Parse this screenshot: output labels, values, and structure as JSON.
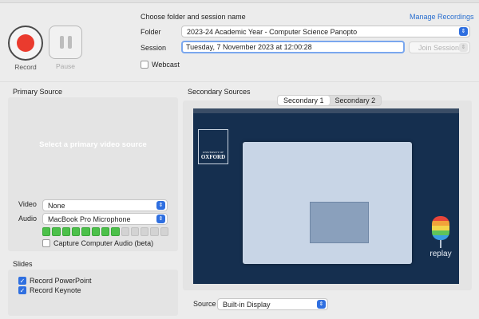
{
  "recording": {
    "record_label": "Record",
    "pause_label": "Pause"
  },
  "session": {
    "choose_label": "Choose folder and session name",
    "manage_link": "Manage Recordings",
    "folder_label": "Folder",
    "folder_value": "2023-24 Academic Year - Computer Science Panopto",
    "session_label": "Session",
    "session_value": "Tuesday, 7 November 2023 at 12:00:28",
    "join_label": "Join Session",
    "webcast_label": "Webcast",
    "webcast_checked": false
  },
  "primary": {
    "title": "Primary Source",
    "message": "Select a primary video source",
    "video_label": "Video",
    "video_value": "None",
    "audio_label": "Audio",
    "audio_value": "MacBook Pro Microphone",
    "audio_level_segments_lit": 8,
    "audio_level_segments_total": 13,
    "capture_label": "Capture Computer Audio (beta)",
    "capture_checked": false
  },
  "slides": {
    "title": "Slides",
    "powerpoint_label": "Record PowerPoint",
    "powerpoint_checked": true,
    "keynote_label": "Record Keynote",
    "keynote_checked": true
  },
  "secondary": {
    "title": "Secondary Sources",
    "tabs": [
      {
        "label": "Secondary 1",
        "active": true
      },
      {
        "label": "Secondary 2",
        "active": false
      }
    ],
    "source_label": "Source",
    "source_value": "Built-in Display",
    "preview": {
      "logo_line1": "UNIVERSITY OF",
      "logo_line2": "OXFORD",
      "replay_text": "replay"
    }
  },
  "colors": {
    "record": "#ea3b2e",
    "accent": "#2f6fe0",
    "link": "#2a6fcf",
    "meter_on": "#4cc04a",
    "preview_bg": "#152f4f"
  }
}
